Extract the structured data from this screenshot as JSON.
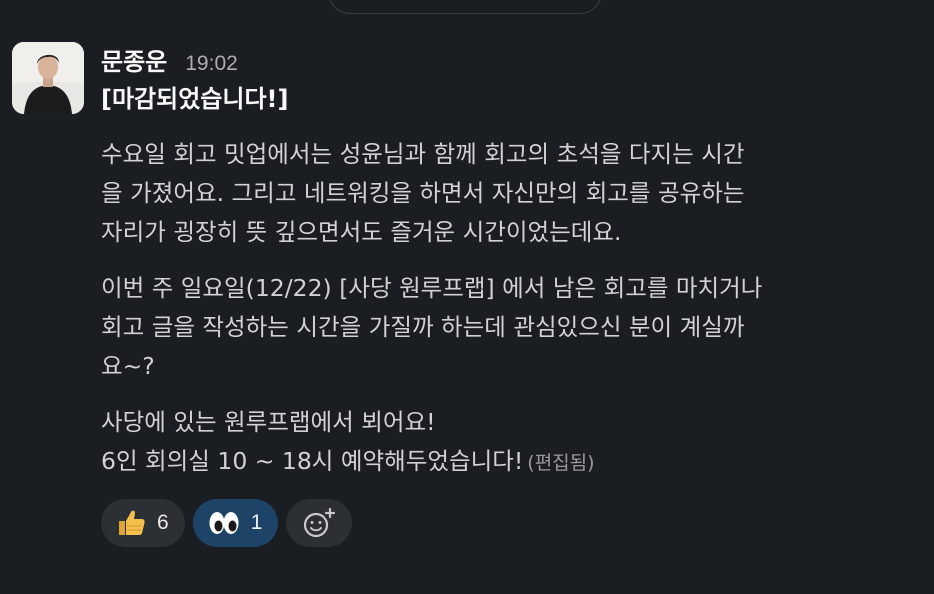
{
  "message": {
    "author": "문종운",
    "timestamp": "19:02",
    "headline": "[마감되었습니다!]",
    "paragraphs": [
      {
        "lines": [
          "수요일 회고 밋업에서는 성윤님과 함께 회고의 초석을 다지는 시간",
          "을 가졌어요. 그리고 네트워킹을 하면서 자신만의 회고를 공유하는",
          "자리가 굉장히 뜻 깊으면서도 즐거운 시간이었는데요."
        ]
      },
      {
        "lines": [
          "이번 주 일요일(12/22) [사당 원루프랩] 에서 남은 회고를 마치거나",
          "회고 글을 작성하는 시간을 가질까 하는데 관심있으신 분이 계실까",
          "요~?"
        ]
      },
      {
        "lines": [
          "사당에 있는 원루프랩에서 뵈어요!",
          "6인 회의실 10 ~ 18시 예약해두었습니다!"
        ],
        "edited_label": "(편집됨)"
      }
    ],
    "reactions": [
      {
        "icon": "thumbs-up-icon",
        "count": "6",
        "active": false
      },
      {
        "icon": "eyes-icon",
        "count": "1",
        "active": true
      }
    ],
    "add_reaction_icon": "add-reaction-icon"
  },
  "colors": {
    "background": "#1a1d21",
    "text": "#d1d2d3",
    "author": "#f8f8f8",
    "timestamp": "#abadb0",
    "reaction_bg": "#2c2f33",
    "reaction_active_bg": "#1d4366"
  }
}
